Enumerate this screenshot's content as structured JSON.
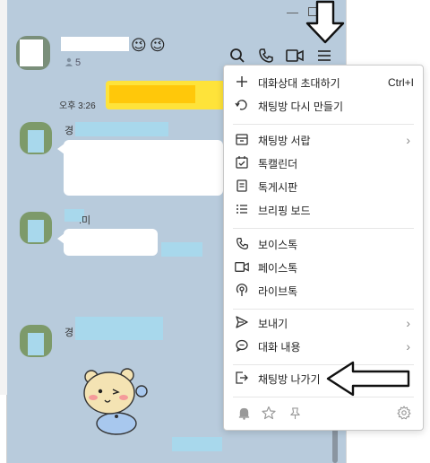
{
  "window": {
    "minimize_glyph": "—",
    "member_count": "5",
    "emoji_1": "😉",
    "emoji_2": "😉"
  },
  "toolbar": {
    "search_icon": "search-icon",
    "call_icon": "phone-icon",
    "video_icon": "video-icon",
    "menu_icon": "hamburger-menu-icon"
  },
  "messages": {
    "time": "오후 3:26",
    "sender_1": "경",
    "sender_2": ".미",
    "sender_3": "경"
  },
  "menu": {
    "items": [
      {
        "label": "대화상대 초대하기",
        "shortcut": "Ctrl+I",
        "icon": "plus-icon"
      },
      {
        "label": "채팅방 다시 만들기",
        "icon": "refresh-chat-icon"
      },
      {
        "label": "채팅방 서랍",
        "icon": "drawer-icon",
        "chevron": "›"
      },
      {
        "label": "톡캘린더",
        "icon": "calendar-check-icon"
      },
      {
        "label": "톡게시판",
        "icon": "board-icon"
      },
      {
        "label": "브리핑 보드",
        "icon": "list-icon"
      },
      {
        "label": "보이스톡",
        "icon": "phone-icon"
      },
      {
        "label": "페이스톡",
        "icon": "video-icon"
      },
      {
        "label": "라이브톡",
        "icon": "broadcast-icon"
      },
      {
        "label": "보내기",
        "icon": "send-icon",
        "chevron": "›"
      },
      {
        "label": "대화 내용",
        "icon": "chat-bubble-icon",
        "chevron": "›"
      },
      {
        "label": "채팅방 나가기",
        "icon": "exit-icon"
      }
    ],
    "footer_icons": [
      "bell-icon",
      "star-icon",
      "pin-icon",
      "settings-icon"
    ]
  },
  "colors": {
    "chat_bg": "#b8cbdc",
    "bubble_yellow": "#fee33a",
    "redact_blue": "#a8d8ec"
  }
}
